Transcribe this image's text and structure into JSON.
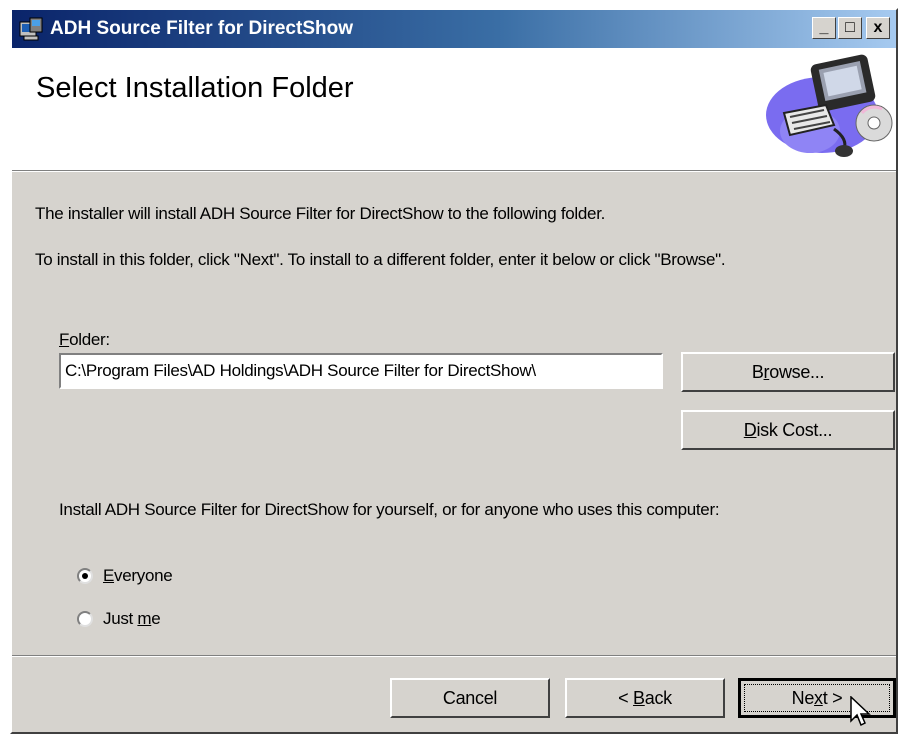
{
  "window": {
    "title": "ADH Source Filter for DirectShow",
    "controls": {
      "minimize": "_",
      "maximize": "□",
      "close": "x"
    }
  },
  "header": {
    "title": "Select Installation Folder",
    "graphic": "computer-with-cd-icon"
  },
  "body": {
    "intro_line1": "The installer will install ADH Source Filter for DirectShow to the following folder.",
    "intro_line2": "To install in this folder, click \"Next\". To install to a different folder, enter it below or click \"Browse\".",
    "folder_label_mnemonic": "F",
    "folder_label_rest": "older:",
    "folder_value": "C:\\Program Files\\AD Holdings\\ADH Source Filter for DirectShow\\",
    "browse_pre": "B",
    "browse_mnemonic": "r",
    "browse_post": "owse...",
    "disk_cost_mnemonic": "D",
    "disk_cost_rest": "isk Cost...",
    "install_for_text": "Install ADH Source Filter for DirectShow for yourself, or for anyone who uses this computer:",
    "options": [
      {
        "mnemonic": "E",
        "rest": "veryone",
        "selected": true
      },
      {
        "pre": "Just ",
        "mnemonic": "m",
        "rest": "e",
        "selected": false
      }
    ]
  },
  "footer": {
    "cancel": "Cancel",
    "back_pre": "< ",
    "back_mnemonic": "B",
    "back_rest": "ack",
    "next_pre": "Ne",
    "next_mnemonic": "x",
    "next_rest": "t >"
  },
  "colors": {
    "dialog_bg": "#d6d3ce",
    "titlebar_start": "#0a246a",
    "titlebar_end": "#a6caf0"
  }
}
